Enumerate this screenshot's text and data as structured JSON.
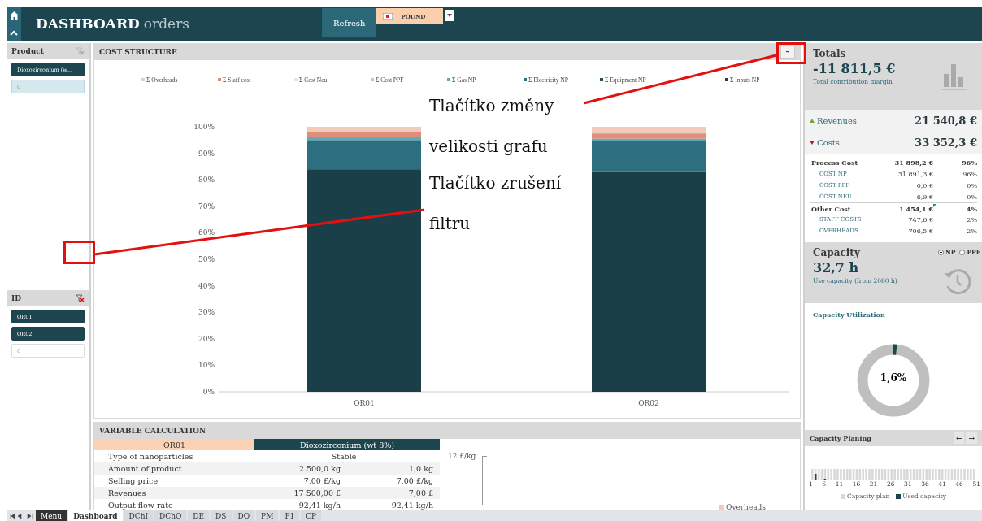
{
  "header": {
    "title": "DASHBOARD",
    "subtitle": "orders",
    "refresh_button": "Refresh",
    "currency": "POUND"
  },
  "filters": [
    {
      "title": "Product",
      "filter_active": false,
      "items": [
        {
          "label": "Dioxozirconium (w...",
          "selected": true,
          "has_data": true
        },
        {
          "label": "0",
          "selected": false,
          "has_data": true
        }
      ]
    },
    {
      "title": "ID",
      "filter_active": true,
      "items": [
        {
          "label": "OR01",
          "selected": true,
          "has_data": true
        },
        {
          "label": "OR02",
          "selected": true,
          "has_data": true
        },
        {
          "label": "0",
          "selected": false,
          "has_data": false
        }
      ]
    }
  ],
  "cost_structure": {
    "title": "COST STRUCTURE",
    "chart_data": {
      "type": "bar",
      "stacked": true,
      "legend": "top",
      "categories": [
        "OR01",
        "OR02"
      ],
      "ylim": [
        0,
        100
      ],
      "yticks": [
        {
          "value": 0,
          "label": "0%"
        },
        {
          "value": 10,
          "label": "10%"
        },
        {
          "value": 20,
          "label": "20%"
        },
        {
          "value": 30,
          "label": "30%"
        },
        {
          "value": 40,
          "label": "40%"
        },
        {
          "value": 50,
          "label": "50%"
        },
        {
          "value": 60,
          "label": "60%"
        },
        {
          "value": 70,
          "label": "70%"
        },
        {
          "value": 80,
          "label": "80%"
        },
        {
          "value": 90,
          "label": "90%"
        },
        {
          "value": 100,
          "label": "100%"
        }
      ],
      "series": [
        {
          "name": "Σ Inputs NP",
          "color": "#1b3f49",
          "values": [
            84,
            83
          ]
        },
        {
          "name": "Σ Equipment NP",
          "color": "#24525e",
          "values": [
            0,
            0
          ]
        },
        {
          "name": "Σ Electricity NP",
          "color": "#2d6e7f",
          "values": [
            11,
            11.5
          ]
        },
        {
          "name": "Σ Gas NP",
          "color": "#5ea9bd",
          "values": [
            1,
            1
          ]
        },
        {
          "name": "Σ Cost PPF",
          "color": "#a8d4e0",
          "values": [
            0,
            0
          ]
        },
        {
          "name": "Σ Cost Neu",
          "color": "#dce9ee",
          "values": [
            0,
            0
          ]
        },
        {
          "name": "Σ Staff cost",
          "color": "#dd8f78",
          "values": [
            2,
            2
          ]
        },
        {
          "name": "Σ Overheads",
          "color": "#f3c9bb",
          "values": [
            2,
            2.5
          ]
        }
      ]
    }
  },
  "variable_calculation": {
    "title": "VARIABLE CALCULATION",
    "heading": {
      "order": "OR01",
      "product": "Dioxozirconium (wt 8%)"
    },
    "rows": [
      {
        "label": "Type of nanoparticles",
        "cells": [
          "Stable"
        ]
      },
      {
        "label": "Amount of product",
        "cells": [
          "2 500,0 kg",
          "1,0 kg"
        ]
      },
      {
        "label": "Selling price",
        "cells": [
          "7,00 £/kg",
          "7,00 £/kg"
        ]
      },
      {
        "label": "Revenues",
        "cells": [
          "17 500,00 £",
          "7,00 £"
        ]
      },
      {
        "label": "Output flow rate",
        "cells": [
          "92,41 kg/h",
          "92,41 kg/h"
        ]
      }
    ],
    "side_chart": {
      "axis_label": "12 £/kg",
      "legend": "Overheads"
    }
  },
  "totals": {
    "title": "Totals",
    "value": "-11 811,5 €",
    "caption": "Total contribution margin",
    "revenues": {
      "label": "Revenues",
      "value": "21 540,8 €"
    },
    "costs": {
      "label": "Costs",
      "value": "33 352,3 €"
    },
    "breakdown": [
      {
        "kind": "group",
        "label": "Process Cost",
        "value": "31 898,2 €",
        "share": "96%",
        "commented": false
      },
      {
        "kind": "item",
        "label": "COST NP",
        "value": "31 891,3 €",
        "share": "96%",
        "commented": false
      },
      {
        "kind": "item",
        "label": "COST PPF",
        "value": "0,0 €",
        "share": "0%",
        "commented": false
      },
      {
        "kind": "item",
        "label": "COST NEU",
        "value": "6,9 €",
        "share": "0%",
        "commented": false
      },
      {
        "kind": "group",
        "label": "Other Cost",
        "value": "1 454,1 €",
        "share": "4%",
        "commented": true
      },
      {
        "kind": "item",
        "label": "STAFF COSTS",
        "value": "747,6 €",
        "share": "2%",
        "commented": false
      },
      {
        "kind": "item",
        "label": "OVERHEADS",
        "value": "706,5 €",
        "share": "2%",
        "commented": false
      }
    ]
  },
  "capacity": {
    "title": "Capacity",
    "value": "32,7 h",
    "caption": "Use capacity (from 2080 h)",
    "options": [
      {
        "label": "NP",
        "selected": true
      },
      {
        "label": "PPF",
        "selected": false
      }
    ]
  },
  "utilization": {
    "title": "Capacity Utilization",
    "value": "1,6%",
    "level": 0.016
  },
  "planning": {
    "title": "Capacity Planing",
    "nav": [
      "←",
      "→"
    ],
    "weeks": [
      "1",
      "6",
      "11",
      "16",
      "21",
      "26",
      "31",
      "36",
      "41",
      "46",
      "51"
    ],
    "legend": [
      {
        "label": "Capacity plan",
        "color": "#d9d9d9"
      },
      {
        "label": "Used capacity",
        "color": "#1d4550"
      }
    ]
  },
  "sheet_tabs": [
    {
      "label": "Menu",
      "kind": "menu",
      "selected": false
    },
    {
      "label": "Dashboard",
      "kind": "sheet",
      "selected": true
    },
    {
      "label": "DChI",
      "kind": "sheet",
      "selected": false
    },
    {
      "label": "DChO",
      "kind": "sheet",
      "selected": false
    },
    {
      "label": "DE",
      "kind": "sheet",
      "selected": false
    },
    {
      "label": "DS",
      "kind": "sheet",
      "selected": false
    },
    {
      "label": "DO",
      "kind": "sheet",
      "selected": false
    },
    {
      "label": "PM",
      "kind": "sheet",
      "selected": false
    },
    {
      "label": "P1",
      "kind": "sheet",
      "selected": false
    },
    {
      "label": "CP",
      "kind": "sheet",
      "selected": false
    }
  ],
  "annotations": [
    {
      "lines": [
        "Tlačítko změny",
        "velikosti grafu"
      ]
    },
    {
      "lines": [
        "Tlačítko zrušení",
        "filtru"
      ]
    }
  ]
}
